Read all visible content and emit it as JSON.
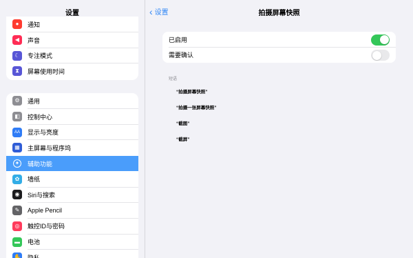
{
  "sidebar": {
    "title": "设置",
    "group1": [
      {
        "label": "通知",
        "icon": "bell-icon",
        "glyph": "●",
        "color": "#ff3b30"
      },
      {
        "label": "声音",
        "icon": "speaker-icon",
        "glyph": "◀",
        "color": "#ff2d55"
      },
      {
        "label": "专注模式",
        "icon": "moon-icon",
        "glyph": "☾",
        "color": "#5856d6"
      },
      {
        "label": "屏幕使用时间",
        "icon": "hourglass-icon",
        "glyph": "⧗",
        "color": "#5856d6"
      }
    ],
    "group2": [
      {
        "label": "通用",
        "icon": "gear-icon",
        "glyph": "⚙",
        "color": "#8e8e93"
      },
      {
        "label": "控制中心",
        "icon": "control-center-icon",
        "glyph": "◧",
        "color": "#8e8e93"
      },
      {
        "label": "显示与亮度",
        "icon": "display-brightness-icon",
        "glyph": "AA",
        "color": "#2f7cf6"
      },
      {
        "label": "主屏幕与程序坞",
        "icon": "home-screen-icon",
        "glyph": "▦",
        "color": "#2f5cd6"
      },
      {
        "label": "辅助功能",
        "icon": "accessibility-icon",
        "glyph": "✦",
        "color": "#2f7cf6",
        "selected": true
      },
      {
        "label": "墙纸",
        "icon": "wallpaper-icon",
        "glyph": "✿",
        "color": "#32ade6"
      },
      {
        "label": "Siri与搜索",
        "icon": "siri-icon",
        "glyph": "◉",
        "color": "#1c1c1e"
      },
      {
        "label": "Apple Pencil",
        "icon": "pencil-icon",
        "glyph": "✎",
        "color": "#636366"
      },
      {
        "label": "触控ID与密码",
        "icon": "fingerprint-icon",
        "glyph": "◎",
        "color": "#ff3b5c"
      },
      {
        "label": "电池",
        "icon": "battery-icon",
        "glyph": "▬",
        "color": "#34c759"
      },
      {
        "label": "隐私",
        "icon": "privacy-hand-icon",
        "glyph": "✋",
        "color": "#2f7cf6"
      }
    ]
  },
  "nav": {
    "back_label": "设置",
    "title": "拍摄屏幕快照"
  },
  "settings": {
    "enabled_label": "已启用",
    "enabled": true,
    "confirm_label": "需要确认",
    "confirm": false
  },
  "phrases": {
    "header": "短语",
    "items": [
      "“拍摄屏幕快照”",
      "“拍摄一张屏幕快照”",
      "“截图”",
      "“截屏”"
    ]
  }
}
